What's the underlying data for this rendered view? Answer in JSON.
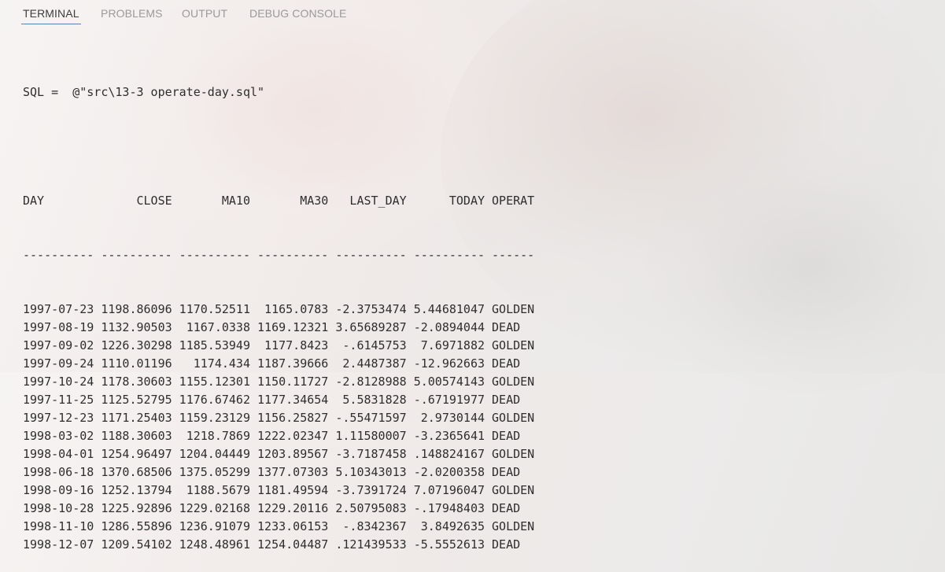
{
  "panel": {
    "tabs": [
      {
        "label": "TERMINAL",
        "active": true
      },
      {
        "label": "PROBLEMS",
        "active": false
      },
      {
        "label": "OUTPUT",
        "active": false
      },
      {
        "label": "DEBUG CONSOLE",
        "active": false
      }
    ]
  },
  "terminal": {
    "command": "SQL =  @\"src\\13-3 operate-day.sql\"",
    "header": "DAY             CLOSE       MA10       MA30   LAST_DAY      TODAY OPERAT",
    "separator": "---------- ---------- ---------- ---------- ---------- ---------- ------",
    "rows": [
      "1997-07-23 1198.86096 1170.52511  1165.0783 -2.3753474 5.44681047 GOLDEN",
      "1997-08-19 1132.90503  1167.0338 1169.12321 3.65689287 -2.0894044 DEAD",
      "1997-09-02 1226.30298 1185.53949  1177.8423  -.6145753  7.6971882 GOLDEN",
      "1997-09-24 1110.01196   1174.434 1187.39666  2.4487387 -12.962663 DEAD",
      "1997-10-24 1178.30603 1155.12301 1150.11727 -2.8128988 5.00574143 GOLDEN",
      "1997-11-25 1125.52795 1176.67462 1177.34654  5.5831828 -.67191977 DEAD",
      "1997-12-23 1171.25403 1159.23129 1156.25827 -.55471597  2.9730144 GOLDEN",
      "1998-03-02 1188.30603  1218.7869 1222.02347 1.11580007 -3.2365641 DEAD",
      "1998-04-01 1254.96497 1204.04449 1203.89567 -3.7187458 .148824167 GOLDEN",
      "1998-06-18 1370.68506 1375.05299 1377.07303 5.10343013 -2.0200358 DEAD",
      "1998-09-16 1252.13794  1188.5679 1181.49594 -3.7391724 7.07196047 GOLDEN",
      "1998-10-28 1225.92896 1229.02168 1229.20116 2.50795083 -.17948403 DEAD",
      "1998-11-10 1286.55896 1236.91079 1233.06153  -.8342367  3.8492635 GOLDEN",
      "1998-12-07 1209.54102 1248.48961 1254.04487 .121439533 -5.5552613 DEAD"
    ]
  }
}
